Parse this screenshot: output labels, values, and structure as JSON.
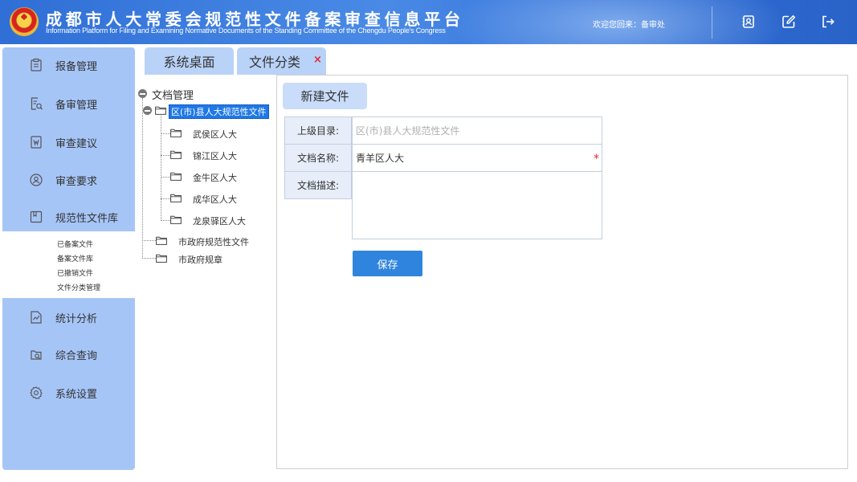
{
  "header": {
    "title": "成都市人大常委会规范性文件备案审查信息平台",
    "subtitle": "Information Platform for Filing and Examining Normative Documents of the Standing Committee of the Chengdu People's Congress",
    "welcome": "欢迎您回来：备审处",
    "icons": [
      "contact-icon",
      "edit-icon",
      "logout-icon"
    ]
  },
  "sidebar": {
    "items": [
      {
        "label": "报备管理",
        "icon": "clipboard-icon"
      },
      {
        "label": "备审管理",
        "icon": "document-search-icon"
      },
      {
        "label": "审查建议",
        "icon": "suggestion-icon"
      },
      {
        "label": "审查要求",
        "icon": "user-circle-icon"
      },
      {
        "label": "规范性文件库",
        "icon": "library-icon"
      },
      {
        "label": "统计分析",
        "icon": "chart-icon"
      },
      {
        "label": "综合查询",
        "icon": "query-icon"
      },
      {
        "label": "系统设置",
        "icon": "gear-icon"
      }
    ],
    "sub_items": [
      "已备案文件",
      "备案文件库",
      "已撤销文件",
      "文件分类管理"
    ]
  },
  "tabs": [
    {
      "label": "系统桌面"
    },
    {
      "label": "文件分类",
      "close": "×"
    }
  ],
  "tree": {
    "root": "文档管理",
    "selected": "区(市)县人大规范性文件",
    "children": [
      "武侯区人大",
      "锦江区人大",
      "金牛区人大",
      "成华区人大",
      "龙泉驿区人大"
    ],
    "siblings": [
      "市政府规范性文件",
      "市政府规章"
    ]
  },
  "form": {
    "new_button": "新建文件",
    "parent_label": "上级目录:",
    "parent_value": "区(市)县人大规范性文件",
    "name_label": "文档名称:",
    "name_value": "青羊区人大",
    "required_mark": "*",
    "desc_label": "文档描述:",
    "desc_value": "",
    "save_button": "保存"
  },
  "colors": {
    "header_blue": "#2f6fd6",
    "sidebar_blue": "#a6c5f7",
    "tab_blue": "#b9d2f8",
    "save_blue": "#2f85de",
    "required_red": "#e02a2a",
    "selected_blue": "#1e78e8"
  }
}
